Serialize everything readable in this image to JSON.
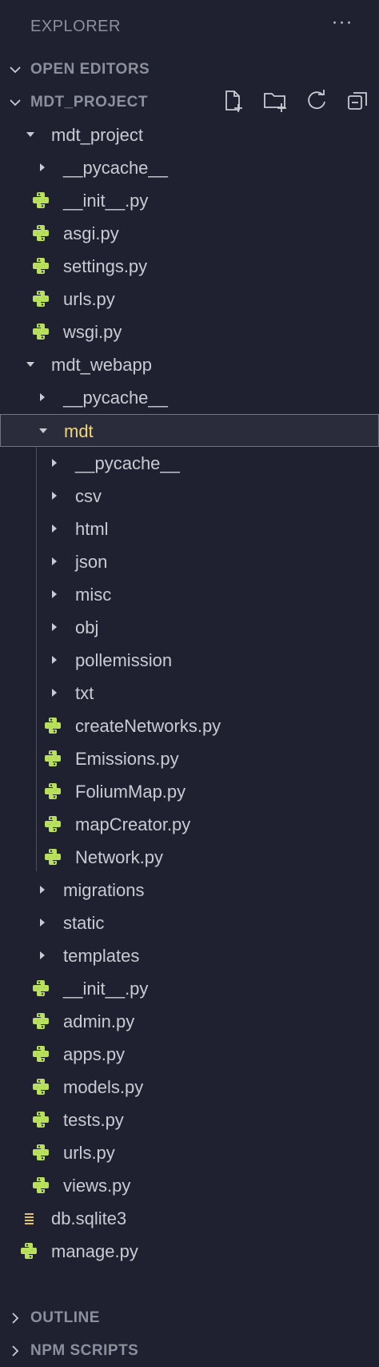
{
  "header": {
    "title": "EXPLORER",
    "more_label": "···"
  },
  "sections": {
    "open_editors": "OPEN EDITORS",
    "project": "MDT_PROJECT",
    "outline": "OUTLINE",
    "npm_scripts": "NPM SCRIPTS"
  },
  "toolbar": {
    "new_file_icon": "new-file-icon",
    "new_folder_icon": "new-folder-icon",
    "refresh_icon": "refresh-icon",
    "collapse_icon": "collapse-all-icon"
  },
  "tree": [
    {
      "label": "mdt_project",
      "kind": "folder",
      "open": true
    },
    {
      "label": "__pycache__",
      "kind": "folder",
      "open": false
    },
    {
      "label": "__init__.py",
      "kind": "py"
    },
    {
      "label": "asgi.py",
      "kind": "py"
    },
    {
      "label": "settings.py",
      "kind": "py"
    },
    {
      "label": "urls.py",
      "kind": "py"
    },
    {
      "label": "wsgi.py",
      "kind": "py"
    },
    {
      "label": "mdt_webapp",
      "kind": "folder",
      "open": true
    },
    {
      "label": "__pycache__",
      "kind": "folder",
      "open": false
    },
    {
      "label": "mdt",
      "kind": "folder",
      "open": true,
      "selected": true
    },
    {
      "label": "__pycache__",
      "kind": "folder",
      "open": false
    },
    {
      "label": "csv",
      "kind": "folder",
      "open": false
    },
    {
      "label": "html",
      "kind": "folder",
      "open": false
    },
    {
      "label": "json",
      "kind": "folder",
      "open": false
    },
    {
      "label": "misc",
      "kind": "folder",
      "open": false
    },
    {
      "label": "obj",
      "kind": "folder",
      "open": false
    },
    {
      "label": "pollemission",
      "kind": "folder",
      "open": false
    },
    {
      "label": "txt",
      "kind": "folder",
      "open": false
    },
    {
      "label": "createNetworks.py",
      "kind": "py"
    },
    {
      "label": "Emissions.py",
      "kind": "py"
    },
    {
      "label": "FoliumMap.py",
      "kind": "py"
    },
    {
      "label": "mapCreator.py",
      "kind": "py"
    },
    {
      "label": "Network.py",
      "kind": "py"
    },
    {
      "label": "migrations",
      "kind": "folder",
      "open": false
    },
    {
      "label": "static",
      "kind": "folder",
      "open": false
    },
    {
      "label": "templates",
      "kind": "folder",
      "open": false
    },
    {
      "label": "__init__.py",
      "kind": "py"
    },
    {
      "label": "admin.py",
      "kind": "py"
    },
    {
      "label": "apps.py",
      "kind": "py"
    },
    {
      "label": "models.py",
      "kind": "py"
    },
    {
      "label": "tests.py",
      "kind": "py"
    },
    {
      "label": "urls.py",
      "kind": "py"
    },
    {
      "label": "views.py",
      "kind": "py"
    },
    {
      "label": "db.sqlite3",
      "kind": "db"
    },
    {
      "label": "manage.py",
      "kind": "py"
    }
  ],
  "colors": {
    "background": "#1f2130",
    "text": "#c9cbd3",
    "muted": "#8c8f9c",
    "python_icon": "#b8e05a",
    "selected_text": "#f0d67a",
    "db_icon": "#e8c35a"
  }
}
